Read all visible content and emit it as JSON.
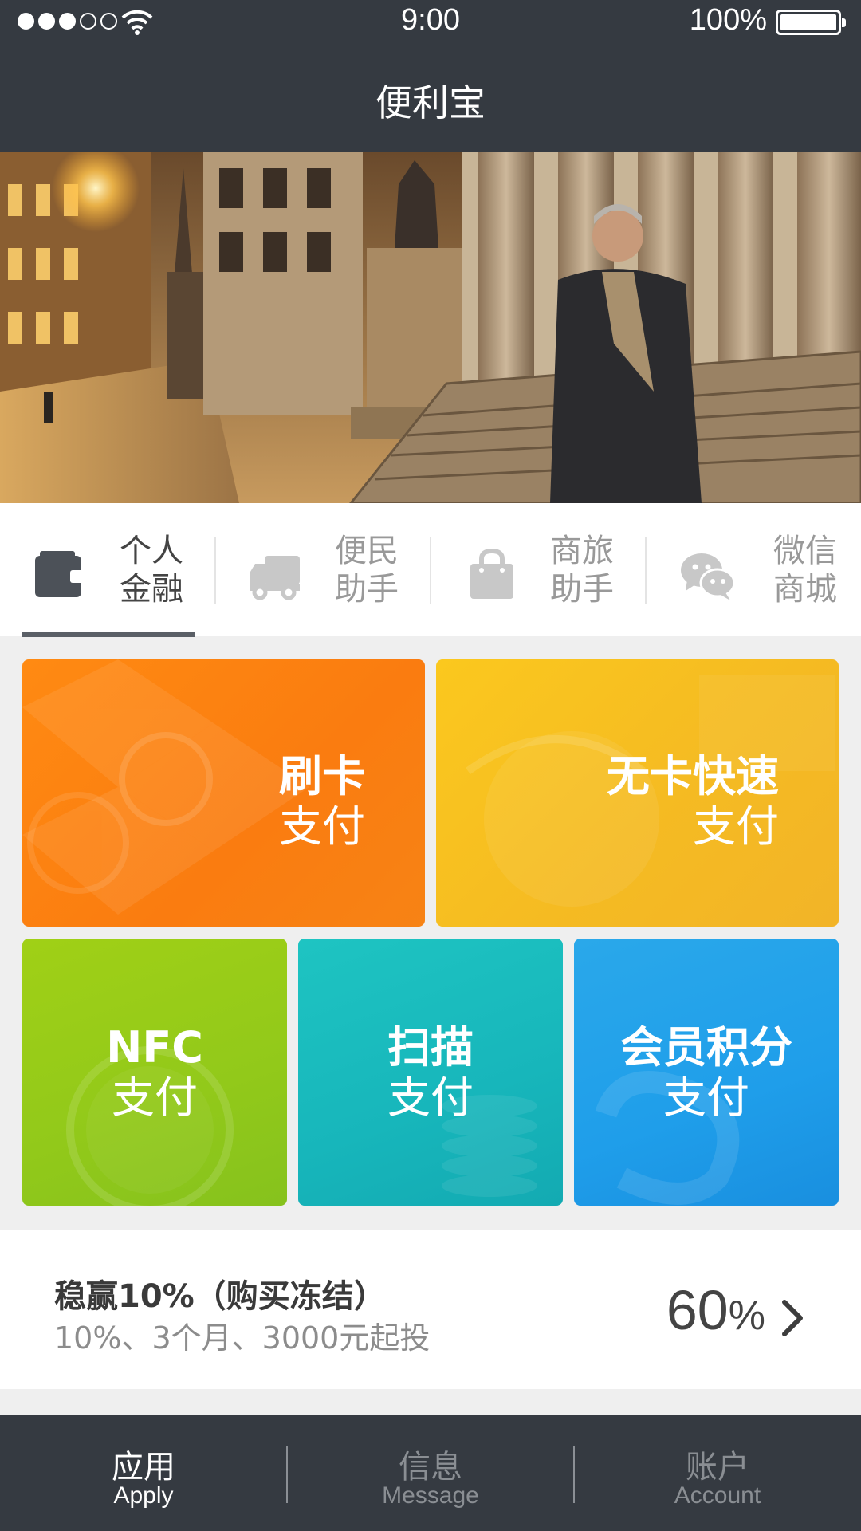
{
  "status_bar": {
    "time": "9:00",
    "battery": "100%"
  },
  "nav": {
    "title": "便利宝"
  },
  "categories": [
    {
      "line1": "个人",
      "line2": "金融",
      "icon": "wallet-icon",
      "active": true
    },
    {
      "line1": "便民",
      "line2": "助手",
      "icon": "truck-icon",
      "active": false
    },
    {
      "line1": "商旅",
      "line2": "助手",
      "icon": "shopping-bag-icon",
      "active": false
    },
    {
      "line1": "微信",
      "line2": "商城",
      "icon": "wechat-icon",
      "active": false
    }
  ],
  "tiles": {
    "swipe": {
      "line1": "刷卡",
      "line2": "支付",
      "color": "#fa7c10"
    },
    "nocard": {
      "line1": "无卡快速",
      "line2": "支付",
      "color": "#f5bb22"
    },
    "nfc": {
      "line1": "NFC",
      "line2": "支付",
      "color": "#92c91a"
    },
    "scan": {
      "line1": "扫描",
      "line2": "支付",
      "color": "#17b6bb"
    },
    "member": {
      "line1": "会员积分",
      "line2": "支付",
      "color": "#1f9eea"
    }
  },
  "product": {
    "title": "稳赢10%（购买冻结）",
    "subtitle": "10%、3个月、3000元起投",
    "rate_number": "60",
    "rate_unit": "%"
  },
  "tabbar": [
    {
      "cn": "应用",
      "en": "Apply",
      "active": true
    },
    {
      "cn": "信息",
      "en": "Message",
      "active": false
    },
    {
      "cn": "账户",
      "en": "Account",
      "active": false
    }
  ]
}
